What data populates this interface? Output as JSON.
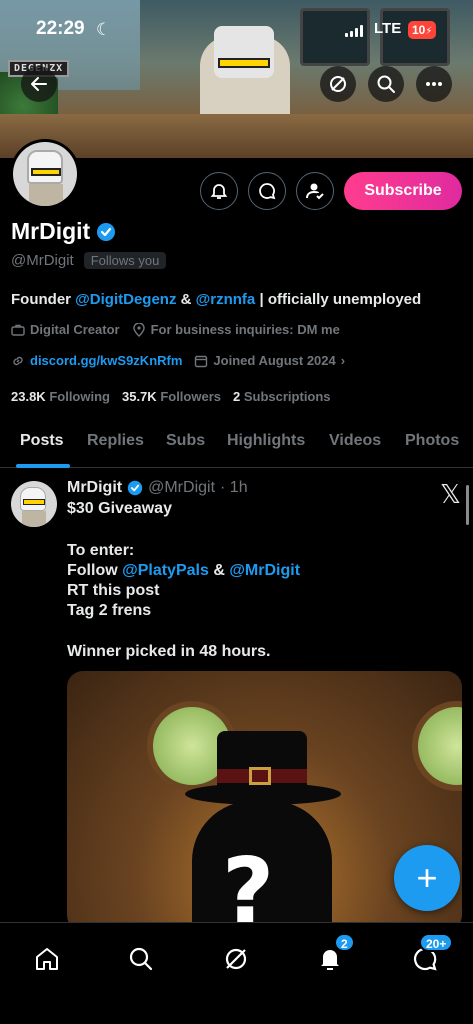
{
  "status_bar": {
    "time": "22:29",
    "network": "LTE",
    "battery": "10"
  },
  "banner": {
    "logo_text": "DEGENZX"
  },
  "top_actions": {
    "back_icon": "arrow-left-icon",
    "grok_icon": "grok-icon",
    "search_icon": "search-icon",
    "more_icon": "more-horizontal-icon"
  },
  "profile": {
    "display_name": "MrDigit",
    "handle": "@MrDigit",
    "follows_you": "Follows you",
    "subscribe_label": "Subscribe",
    "bio": {
      "prefix": "Founder ",
      "mention1": "@DigitDegenz",
      "mid": " & ",
      "mention2": "@rznnfa",
      "suffix": " | officially unemployed"
    },
    "category": "Digital Creator",
    "location": "For business inquiries: DM me",
    "website": "discord.gg/kwS9zKnRfm",
    "joined": "Joined August 2024",
    "stats": {
      "following_count": "23.8K",
      "following_label": "Following",
      "followers_count": "35.7K",
      "followers_label": "Followers",
      "subscriptions_count": "2",
      "subscriptions_label": "Subscriptions"
    }
  },
  "tabs": [
    "Posts",
    "Replies",
    "Subs",
    "Highlights",
    "Videos",
    "Photos"
  ],
  "post": {
    "author": "MrDigit",
    "handle": "@MrDigit",
    "time": "· 1h",
    "line1": "$30 Giveaway",
    "line2": "To enter:",
    "line3_prefix": "Follow ",
    "line3_mention1": "@PlatyPals",
    "line3_mid": " & ",
    "line3_mention2": "@MrDigit",
    "line4": "RT this post",
    "line5": "Tag 2 frens",
    "line6": "Winner picked in 48 hours.",
    "image_text": "?"
  },
  "fab_label": "+",
  "bottom_nav": {
    "notifications_badge": "2",
    "messages_badge": "20+"
  },
  "colors": {
    "accent": "#1d9bf0",
    "subscribe_gradient_start": "#ff3d8e",
    "subscribe_gradient_end": "#e02a9f"
  }
}
